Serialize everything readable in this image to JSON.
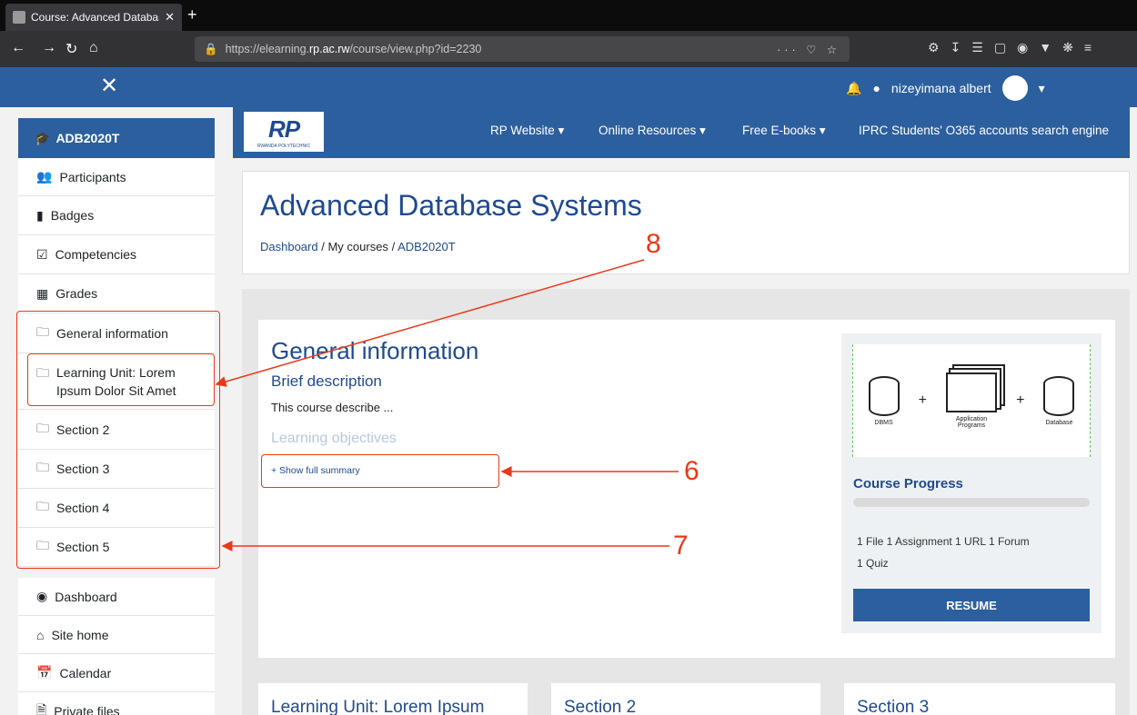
{
  "browser": {
    "tab_title": "Course: Advanced Database Sy",
    "tab_close": "✕",
    "new_tab": "+",
    "url_prefix": "https://elearning.",
    "url_domain": "rp.ac.rw",
    "url_path": "/course/view.php?id=2230",
    "url_actions": "··· ♡ ☆"
  },
  "header": {
    "close": "✕",
    "user_name": "nizeyimana albert"
  },
  "sidebar": {
    "course": "ADB2020T",
    "top_items": [
      "Participants",
      "Badges",
      "Competencies",
      "Grades"
    ],
    "sections": [
      "General information",
      "Learning Unit: Lorem Ipsum Dolor Sit Amet",
      "Section 2",
      "Section 3",
      "Section 4",
      "Section 5"
    ],
    "bottom_items": [
      "Dashboard",
      "Site home",
      "Calendar",
      "Private files"
    ]
  },
  "rpbar": {
    "logo": "RP",
    "logo_sub": "RWANDA POLYTECHNIC",
    "nav": [
      "RP Website ▾",
      "Online Resources ▾",
      "Free E-books ▾",
      "IPRC Students' O365 accounts search engine"
    ]
  },
  "page": {
    "title": "Advanced Database Systems",
    "breadcrumb": [
      "Dashboard",
      "My courses",
      "ADB2020T"
    ]
  },
  "general": {
    "title": "General information",
    "brief": "Brief description",
    "desc": "This course describe ...",
    "objectives": "Learning objectives",
    "show_summary": "+ Show full summary"
  },
  "diagram": {
    "plus": "+",
    "dbms": "DBMS",
    "apps": "Application Programs",
    "database": "Database"
  },
  "progress": {
    "title": "Course Progress",
    "value": 0.0,
    "activities_line1": "1 File  1 Assignment  1 URL  1 Forum",
    "activities_line2": "1 Quiz",
    "resume": "RESUME"
  },
  "bottom_cards": [
    "Learning Unit: Lorem Ipsum",
    "Section 2",
    "Section 3"
  ],
  "annotations": [
    "8",
    "6",
    "7"
  ],
  "colors": {
    "brand": "#2c5f9e",
    "annotation": "#e8391a"
  }
}
